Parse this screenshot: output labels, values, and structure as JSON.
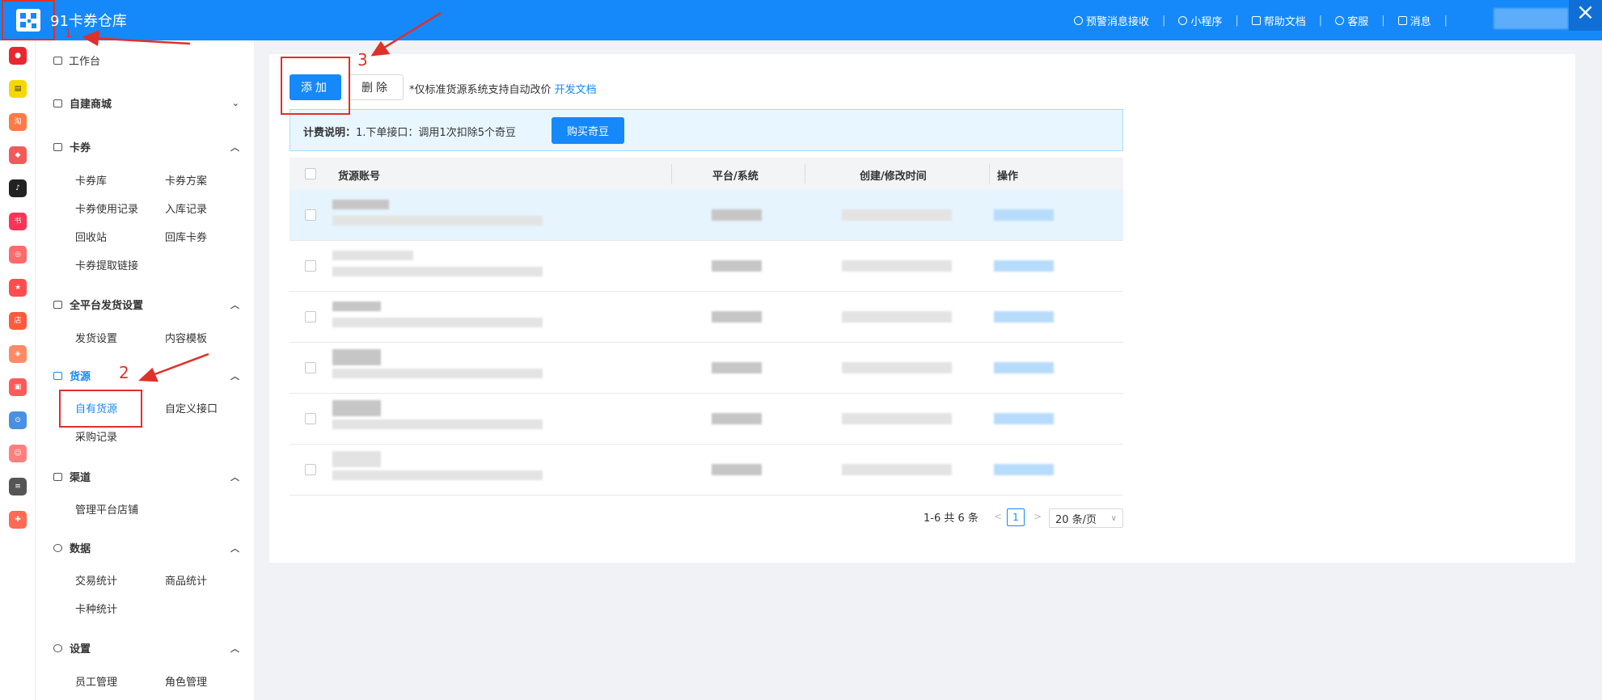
{
  "header": {
    "app_title": "91卡券仓库",
    "menu": [
      {
        "label": "预警消息接收",
        "icon": "bell-icon"
      },
      {
        "label": "小程序",
        "icon": "miniapp-icon"
      },
      {
        "label": "帮助文档",
        "icon": "document-icon"
      },
      {
        "label": "客服",
        "icon": "headset-icon"
      },
      {
        "label": "消息",
        "icon": "mail-icon"
      }
    ],
    "close_glyph": "×"
  },
  "rail": {
    "icons": [
      {
        "name": "rail-app-1-icon",
        "color": "#e8272f",
        "glyph": "●"
      },
      {
        "name": "rail-app-2-icon",
        "color": "#f5d800",
        "glyph": "▤"
      },
      {
        "name": "rail-taobao-icon",
        "color": "#ff7a45",
        "glyph": "淘"
      },
      {
        "name": "rail-app-4-icon",
        "color": "#f25a5a",
        "glyph": "◆"
      },
      {
        "name": "rail-douyin-icon",
        "color": "#222222",
        "glyph": "♪"
      },
      {
        "name": "rail-xiaohongshu-icon",
        "color": "#ff3355",
        "glyph": "书"
      },
      {
        "name": "rail-app-7-icon",
        "color": "#ff6a6a",
        "glyph": "◎"
      },
      {
        "name": "rail-thumb-icon",
        "color": "#ff4d4f",
        "glyph": "★"
      },
      {
        "name": "rail-shop-icon",
        "color": "#ff5a3c",
        "glyph": "店"
      },
      {
        "name": "rail-app-10-icon",
        "color": "#ff8a65",
        "glyph": "◈"
      },
      {
        "name": "rail-app-11-icon",
        "color": "#ff5a5a",
        "glyph": "▣"
      },
      {
        "name": "rail-app-12-icon",
        "color": "#4a90e2",
        "glyph": "⊙"
      },
      {
        "name": "rail-app-13-icon",
        "color": "#ff7f7f",
        "glyph": "☺"
      },
      {
        "name": "rail-app-14-icon",
        "color": "#555555",
        "glyph": "≡"
      },
      {
        "name": "rail-app-15-icon",
        "color": "#ff6a55",
        "glyph": "✚"
      }
    ]
  },
  "sidebar": {
    "workbench": "工作台",
    "mall": "自建商城",
    "coupons": {
      "title": "卡券",
      "items": [
        "卡券库",
        "卡券方案",
        "卡券使用记录",
        "入库记录",
        "回收站",
        "回库卡券",
        "卡券提取链接"
      ]
    },
    "delivery": {
      "title": "全平台发货设置",
      "items": [
        "发货设置",
        "内容模板"
      ]
    },
    "supply": {
      "title": "货源",
      "items": [
        "自有货源",
        "自定义接口",
        "采购记录"
      ]
    },
    "channel": {
      "title": "渠道",
      "items": [
        "管理平台店铺"
      ]
    },
    "data": {
      "title": "数据",
      "items": [
        "交易统计",
        "商品统计",
        "卡种统计"
      ]
    },
    "settings": {
      "title": "设置",
      "items": [
        "员工管理",
        "角色管理"
      ]
    }
  },
  "annotations": {
    "n1": "1",
    "n2": "2",
    "n3": "3",
    "color": "#e0302a"
  },
  "toolbar": {
    "add_label": "添加",
    "delete_label": "删除",
    "note": "*仅标准货源系统支持自动改价",
    "dev_doc_link": "开发文档"
  },
  "billing": {
    "label": "计费说明：",
    "text": "1.下单接口：调用1次扣除5个奇豆",
    "buy_button": "购买奇豆"
  },
  "table": {
    "columns": [
      "货源账号",
      "平台/系统",
      "创建/修改时间",
      "操作"
    ],
    "row_count": 6
  },
  "pagination": {
    "summary": "1-6 共 6 条",
    "current_page": "1",
    "page_size": "20 条/页",
    "prev": "<",
    "next": ">"
  },
  "colors": {
    "brand": "#1589fa",
    "annotation": "#e0302a"
  }
}
